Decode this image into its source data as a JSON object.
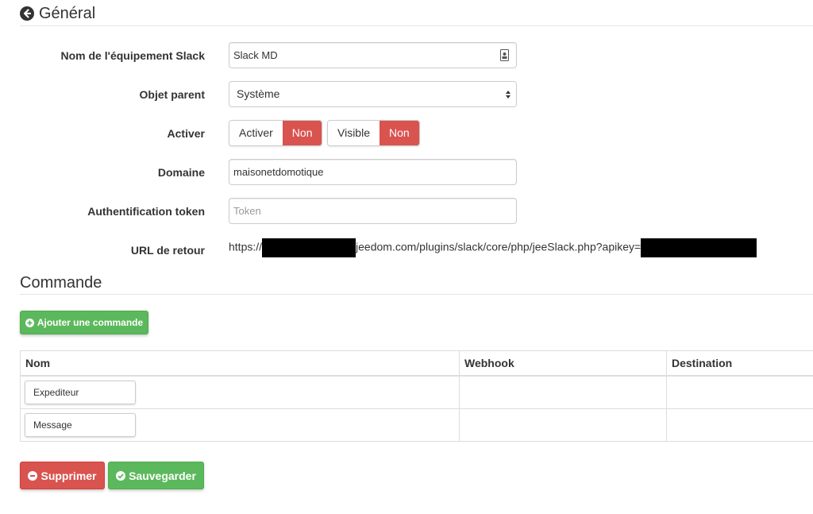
{
  "general": {
    "title": "Général",
    "fields": {
      "name_label": "Nom de l'équipement Slack",
      "name_value": "Slack MD",
      "parent_label": "Objet parent",
      "parent_value": "Système",
      "activate_label": "Activer",
      "activate_toggle_label": "Activer",
      "activate_toggle_value": "Non",
      "visible_toggle_label": "Visible",
      "visible_toggle_value": "Non",
      "domain_label": "Domaine",
      "domain_value": "maisonetdomotique",
      "token_label": "Authentification token",
      "token_placeholder": "Token",
      "url_label": "URL de retour",
      "url_prefix": "https://",
      "url_middle": "jeedom.com/plugins/slack/core/php/jeeSlack.php?apikey="
    }
  },
  "commands": {
    "title": "Commande",
    "add_button": "Ajouter une commande",
    "columns": [
      "Nom",
      "Webhook",
      "Destination"
    ],
    "rows": [
      {
        "name": "Expediteur"
      },
      {
        "name": "Message"
      }
    ]
  },
  "actions": {
    "delete_label": "Supprimer",
    "save_label": "Sauvegarder"
  },
  "colors": {
    "danger": "#d9534f",
    "success": "#5cb85c"
  }
}
